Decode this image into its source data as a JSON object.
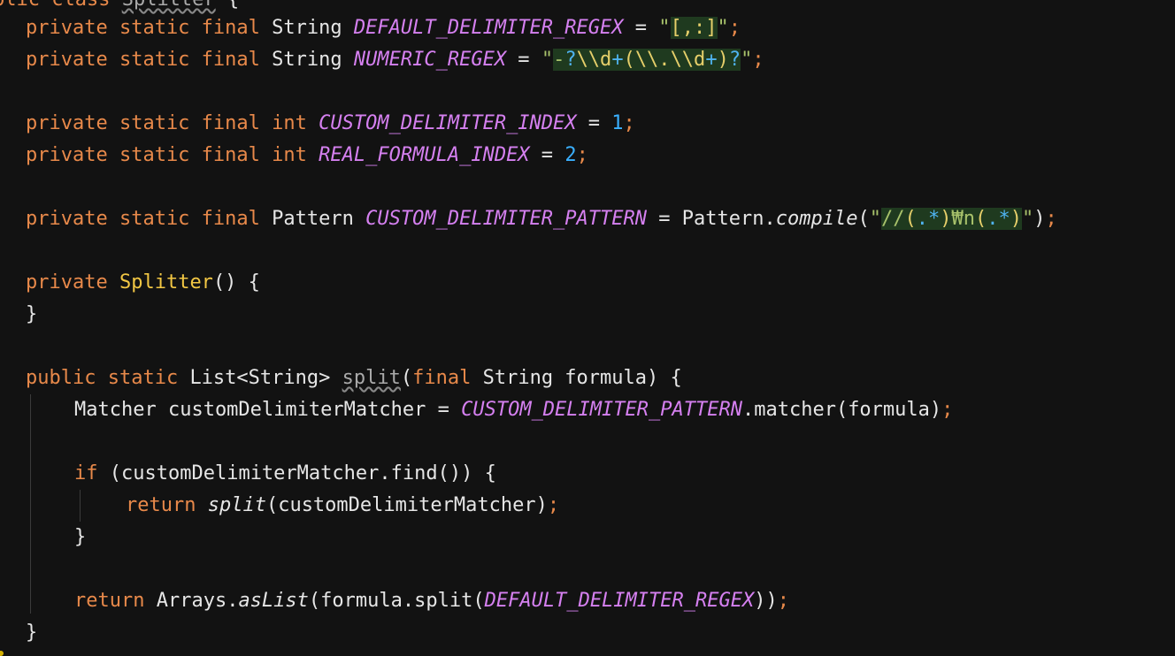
{
  "editor": {
    "line0": {
      "a": "blic class ",
      "b": "Splitter",
      " c": " {"
    },
    "line1": {
      "kw": "private static final ",
      "ty": "String ",
      "cn": "DEFAULT_DELIMITER_REGEX",
      "eq": " = ",
      "q1": "\"",
      "rx": "[,:]",
      "q2": "\"",
      "semi": ";"
    },
    "line2": {
      "kw": "private static final ",
      "ty": "String ",
      "cn": "NUMERIC_REGEX",
      "eq": " = ",
      "q1": "\"",
      "r1": "-",
      "r2": "?",
      "r3": "\\\\d",
      "r4": "+",
      "r5": "(",
      "r6": "\\\\.",
      "r7": "\\\\d",
      "r8": "+",
      "r9": ")",
      "r10": "?",
      "q2": "\"",
      "semi": ";"
    },
    "line3": {
      "kw": "private static final ",
      "ty": "int ",
      "cn": "CUSTOM_DELIMITER_INDEX",
      "eq": " = ",
      "num": "1",
      "semi": ";"
    },
    "line4": {
      "kw": "private static final ",
      "ty": "int ",
      "cn": "REAL_FORMULA_INDEX",
      "eq": " = ",
      "num": "2",
      "semi": ";"
    },
    "line5": {
      "kw": "private static final ",
      "ty": "Pattern ",
      "cn": "CUSTOM_DELIMITER_PATTERN",
      "eq": " = ",
      "cls": "Pattern.",
      "fn": "compile",
      "p1": "(",
      "q1": "\"",
      "r1": "//",
      "r2": "(",
      "r3": ".",
      "r4": "*",
      "r5": ")",
      "r6": "₩n",
      "r7": "(",
      "r8": ".",
      "r9": "*",
      "r10": ")",
      "q2": "\"",
      "p2": ")",
      "semi": ";"
    },
    "line6": {
      "kw": "private ",
      "fn": "Splitter",
      "rest": "() {"
    },
    "line7": {
      "rest": "}"
    },
    "line8": {
      "kw1": "public static ",
      "ty": "List<String> ",
      "fn": "split",
      "p1": "(",
      "kw2": "final ",
      "rest": "String formula) {"
    },
    "line9": {
      "a": "Matcher customDelimiterMatcher = ",
      "cn": "CUSTOM_DELIMITER_PATTERN",
      "b": ".matcher(formula)",
      "semi": ";"
    },
    "line10": {
      "kw": "if ",
      "rest": "(customDelimiterMatcher.find()) {"
    },
    "line11": {
      "kw": "return ",
      "fn": "split",
      "rest": "(customDelimiterMatcher)",
      "semi": ";"
    },
    "line12": {
      "rest": "}"
    },
    "line13": {
      "kw": "return ",
      "a": "Arrays.",
      "fn": "asList",
      "b": "(formula.split(",
      "cn": "DEFAULT_DELIMITER_REGEX",
      "c": "))",
      "semi": ";"
    },
    "line14": {
      "rest": "}"
    }
  }
}
